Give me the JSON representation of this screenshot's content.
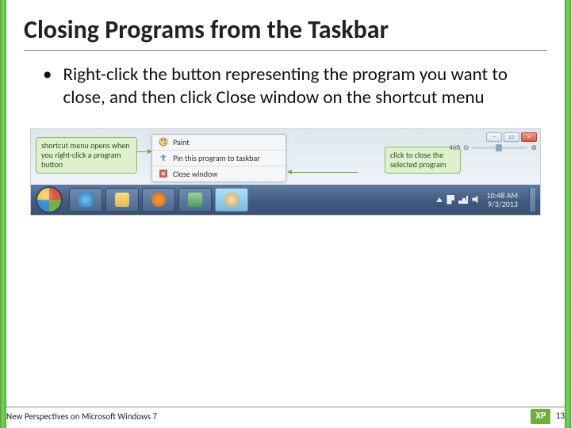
{
  "title": "Closing Programs from the Taskbar",
  "bullet": "Right-click the button representing the program you want to close, and then click Close window on the shortcut menu",
  "figure": {
    "callout_left": "shortcut menu opens when you right-click a program button",
    "callout_right": "click to close the selected program",
    "menu_items": [
      "Paint",
      "Pin this program to taskbar",
      "Close window"
    ],
    "zoom_value": "460",
    "clock_time": "10:48 AM",
    "clock_date": "9/3/2013"
  },
  "footer_text": "New Perspectives on Microsoft Windows 7",
  "page_number": "13",
  "badge": "XP"
}
